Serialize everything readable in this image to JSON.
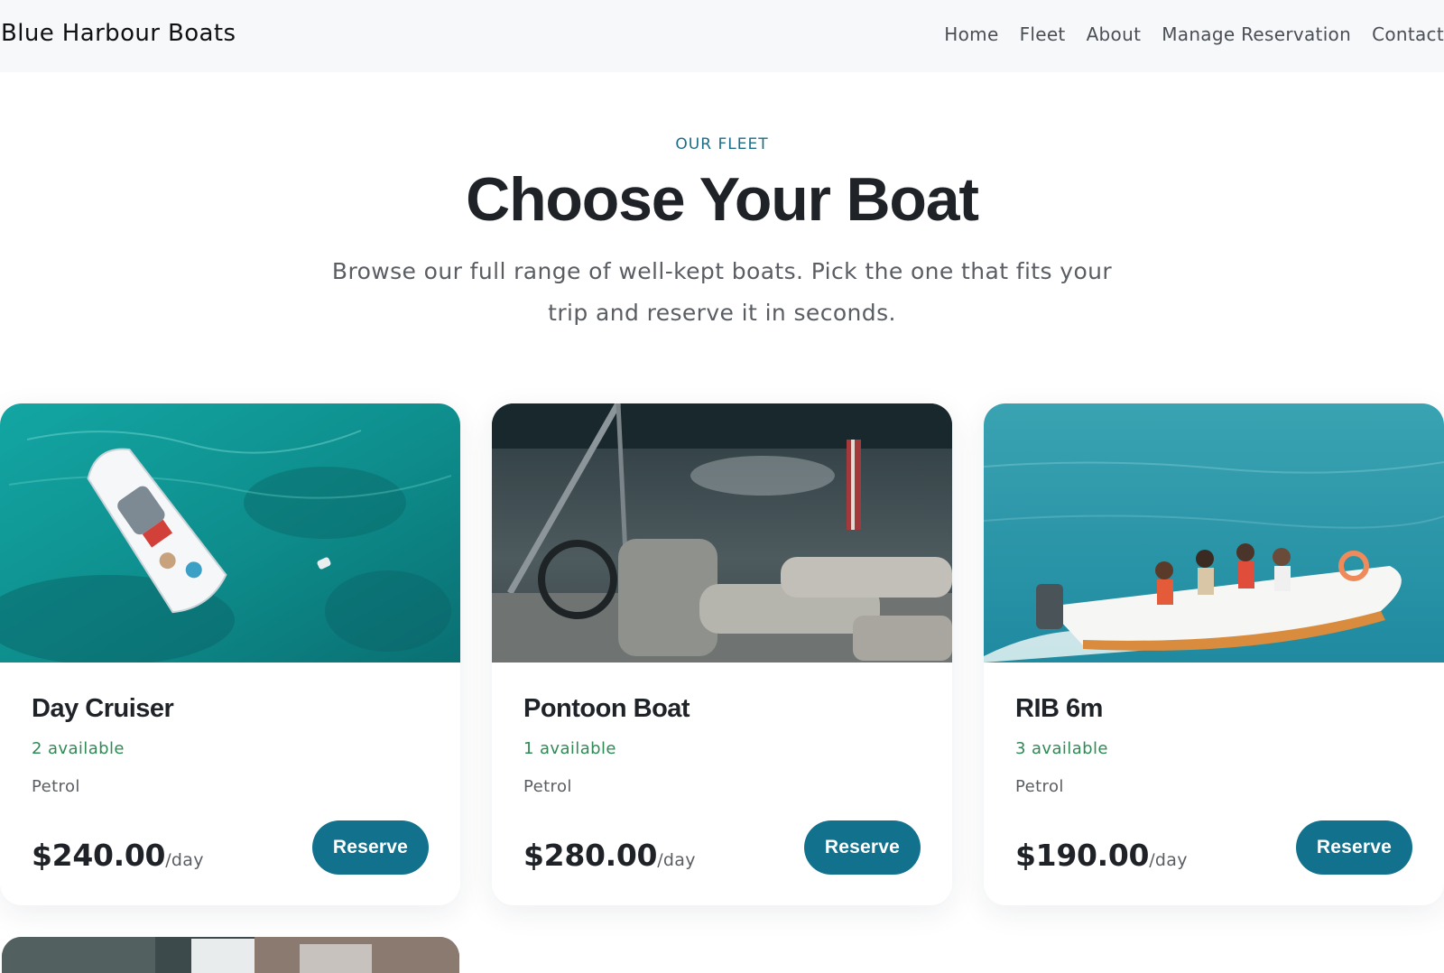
{
  "header": {
    "brand": "Blue Harbour Boats",
    "nav": [
      "Home",
      "Fleet",
      "About",
      "Manage Reservation",
      "Contact"
    ]
  },
  "hero": {
    "eyebrow": "OUR FLEET",
    "title": "Choose Your Boat",
    "subtitle": "Browse our full range of well-kept boats. Pick the one that fits your trip and reserve it in seconds."
  },
  "boats": [
    {
      "name": "Day Cruiser",
      "availability": "2 available",
      "fuel": "Petrol",
      "price": "$240.00",
      "per": "/day",
      "cta": "Reserve"
    },
    {
      "name": "Pontoon Boat",
      "availability": "1 available",
      "fuel": "Petrol",
      "price": "$280.00",
      "per": "/day",
      "cta": "Reserve"
    },
    {
      "name": "RIB 6m",
      "availability": "3 available",
      "fuel": "Petrol",
      "price": "$190.00",
      "per": "/day",
      "cta": "Reserve"
    }
  ],
  "colors": {
    "accent": "#12728e",
    "available": "#2f8a55",
    "eyebrow": "#1a6e88"
  }
}
